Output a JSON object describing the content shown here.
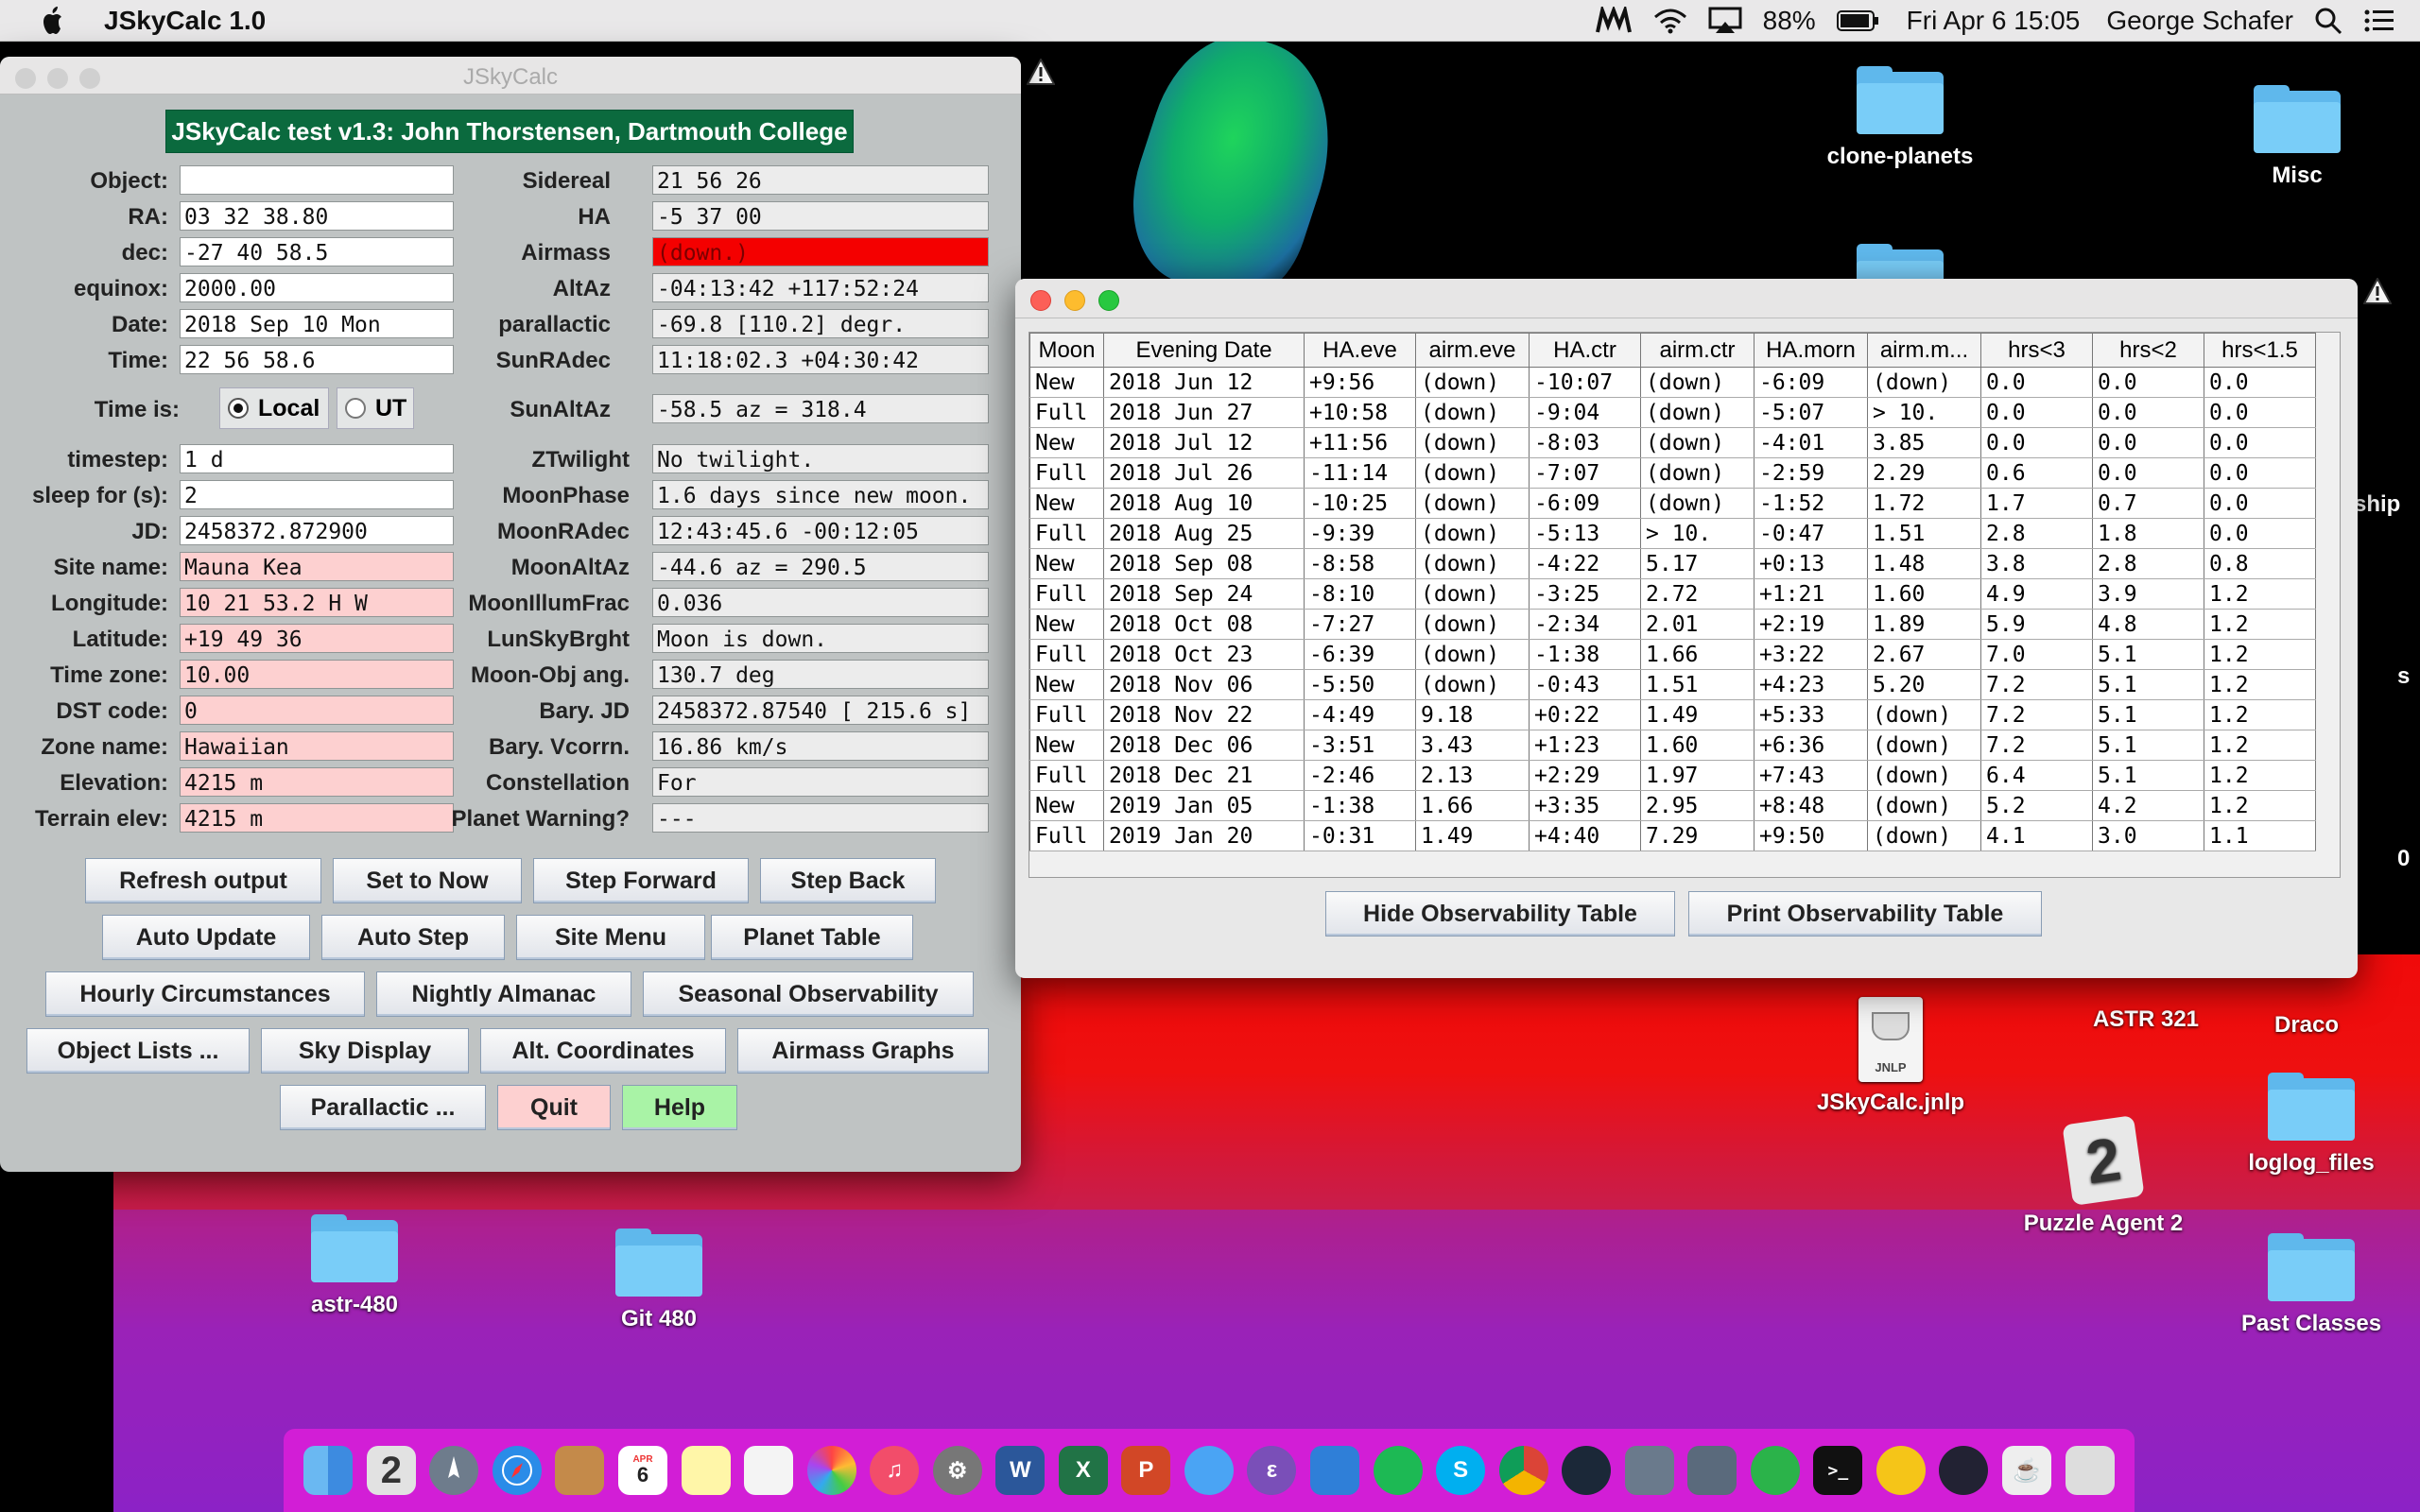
{
  "menubar": {
    "app_name": "JSkyCalc 1.0",
    "battery": "88%",
    "datetime": "Fri Apr 6  15:05",
    "user": "George Schafer"
  },
  "main_window": {
    "title": "JSkyCalc",
    "banner": "JSkyCalc test v1.3: John Thorstensen, Dartmouth College",
    "left_fields": [
      {
        "label": "Object:",
        "value": ""
      },
      {
        "label": "RA:",
        "value": "03 32 38.80"
      },
      {
        "label": "dec:",
        "value": "-27 40 58.5"
      },
      {
        "label": "equinox:",
        "value": "2000.00"
      },
      {
        "label": "Date:",
        "value": "2018 Sep 10  Mon"
      },
      {
        "label": "Time:",
        "value": "22 56 58.6"
      }
    ],
    "right_fields": [
      {
        "label": "Sidereal",
        "value": "21 56 26"
      },
      {
        "label": "HA",
        "value": "-5 37 00"
      },
      {
        "label": "Airmass",
        "value": "(down.)"
      },
      {
        "label": "AltAz",
        "value": "-04:13:42    +117:52:24"
      },
      {
        "label": "parallactic",
        "value": "-69.8  [110.2] degr."
      },
      {
        "label": "SunRAdec",
        "value": "11:18:02.3  +04:30:42"
      }
    ],
    "time_is": {
      "label": "Time is:",
      "local": "Local",
      "ut": "UT",
      "selected": "Local"
    },
    "sunaltaz": {
      "label": "SunAltAz",
      "value": "-58.5   az =  318.4"
    },
    "left_fields2": [
      {
        "label": "timestep:",
        "value": "1 d"
      },
      {
        "label": "sleep for (s):",
        "value": "2"
      },
      {
        "label": "JD:",
        "value": " 2458372.872900"
      },
      {
        "label": "Site name:",
        "value": "Mauna Kea"
      },
      {
        "label": "Longitude:",
        "value": "10 21 53.2 H W"
      },
      {
        "label": "Latitude:",
        "value": "+19 49 36"
      },
      {
        "label": "Time zone:",
        "value": "10.00"
      },
      {
        "label": "DST code:",
        "value": "0"
      },
      {
        "label": "Zone name:",
        "value": " Hawaiian"
      },
      {
        "label": "Elevation:",
        "value": "4215 m"
      },
      {
        "label": "Terrain elev:",
        "value": "4215 m"
      }
    ],
    "right_fields2": [
      {
        "label": "ZTwilight",
        "value": "No twilight."
      },
      {
        "label": "MoonPhase",
        "value": "1.6 days since new moon."
      },
      {
        "label": "MoonRAdec",
        "value": "12:43:45.6  -00:12:05"
      },
      {
        "label": "MoonAltAz",
        "value": "-44.6   az =  290.5"
      },
      {
        "label": "MoonIllumFrac",
        "value": "0.036"
      },
      {
        "label": "LunSkyBrght",
        "value": "Moon is down."
      },
      {
        "label": "Moon-Obj ang.",
        "value": "130.7 deg"
      },
      {
        "label": "Bary. JD",
        "value": "2458372.87540  [ 215.6 s]"
      },
      {
        "label": "Bary. Vcorrn.",
        "value": " 16.86 km/s"
      },
      {
        "label": "Constellation",
        "value": "For"
      },
      {
        "label": "Planet Warning?",
        "value": "---"
      }
    ],
    "buttons": {
      "refresh": "Refresh output",
      "set_now": "Set to Now",
      "step_forward": "Step Forward",
      "step_back": "Step Back",
      "auto_update": "Auto Update",
      "auto_step": "Auto Step",
      "site_menu": "Site  Menu",
      "planet_table": "Planet Table",
      "hourly": "Hourly Circumstances",
      "nightly": "Nightly Almanac",
      "seasonal": "Seasonal Observability",
      "object_lists": "Object Lists ...",
      "sky_display": "Sky Display",
      "alt_coords": "Alt. Coordinates",
      "airmass_graphs": "Airmass Graphs",
      "parallactic": "Parallactic ...",
      "quit": "Quit",
      "help": "Help"
    }
  },
  "obs_window": {
    "headers": [
      "Moon",
      "Evening Date",
      "HA.eve",
      "airm.eve",
      "HA.ctr",
      "airm.ctr",
      "HA.morn",
      "airm.m...",
      "hrs<3",
      "hrs<2",
      "hrs<1.5"
    ],
    "rows": [
      [
        "New",
        "2018 Jun 12",
        "+9:56",
        "(down)",
        "-10:07",
        "(down)",
        "-6:09",
        "(down)",
        "0.0",
        "0.0",
        "0.0"
      ],
      [
        "Full",
        "2018 Jun 27",
        "+10:58",
        "(down)",
        "-9:04",
        "(down)",
        "-5:07",
        "> 10.",
        "0.0",
        "0.0",
        "0.0"
      ],
      [
        "New",
        "2018 Jul 12",
        "+11:56",
        "(down)",
        "-8:03",
        "(down)",
        "-4:01",
        "3.85",
        "0.0",
        "0.0",
        "0.0"
      ],
      [
        "Full",
        "2018 Jul 26",
        "-11:14",
        "(down)",
        "-7:07",
        "(down)",
        "-2:59",
        "2.29",
        "0.6",
        "0.0",
        "0.0"
      ],
      [
        "New",
        "2018 Aug 10",
        "-10:25",
        "(down)",
        "-6:09",
        "(down)",
        "-1:52",
        "1.72",
        "1.7",
        "0.7",
        "0.0"
      ],
      [
        "Full",
        "2018 Aug 25",
        "-9:39",
        "(down)",
        "-5:13",
        "> 10.",
        "-0:47",
        "1.51",
        "2.8",
        "1.8",
        "0.0"
      ],
      [
        "New",
        "2018 Sep 08",
        "-8:58",
        "(down)",
        "-4:22",
        "5.17",
        "+0:13",
        "1.48",
        "3.8",
        "2.8",
        "0.8"
      ],
      [
        "Full",
        "2018 Sep 24",
        "-8:10",
        "(down)",
        "-3:25",
        "2.72",
        "+1:21",
        "1.60",
        "4.9",
        "3.9",
        "1.2"
      ],
      [
        "New",
        "2018 Oct 08",
        "-7:27",
        "(down)",
        "-2:34",
        "2.01",
        "+2:19",
        "1.89",
        "5.9",
        "4.8",
        "1.2"
      ],
      [
        "Full",
        "2018 Oct 23",
        "-6:39",
        "(down)",
        "-1:38",
        "1.66",
        "+3:22",
        "2.67",
        "7.0",
        "5.1",
        "1.2"
      ],
      [
        "New",
        "2018 Nov 06",
        "-5:50",
        "(down)",
        "-0:43",
        "1.51",
        "+4:23",
        "5.20",
        "7.2",
        "5.1",
        "1.2"
      ],
      [
        "Full",
        "2018 Nov 22",
        "-4:49",
        "9.18",
        "+0:22",
        "1.49",
        "+5:33",
        "(down)",
        "7.2",
        "5.1",
        "1.2"
      ],
      [
        "New",
        "2018 Dec 06",
        "-3:51",
        "3.43",
        "+1:23",
        "1.60",
        "+6:36",
        "(down)",
        "7.2",
        "5.1",
        "1.2"
      ],
      [
        "Full",
        "2018 Dec 21",
        "-2:46",
        "2.13",
        "+2:29",
        "1.97",
        "+7:43",
        "(down)",
        "6.4",
        "5.1",
        "1.2"
      ],
      [
        "New",
        "2019 Jan 05",
        "-1:38",
        "1.66",
        "+3:35",
        "2.95",
        "+8:48",
        "(down)",
        "5.2",
        "4.2",
        "1.2"
      ],
      [
        "Full",
        "2019 Jan 20",
        "-0:31",
        "1.49",
        "+4:40",
        "7.29",
        "+9:50",
        "(down)",
        "4.1",
        "3.0",
        "1.1"
      ]
    ],
    "hide_button": "Hide Observability Table",
    "print_button": "Print Observability Table"
  },
  "desktop_icons": {
    "clone_planets": "clone-planets",
    "misc": "Misc",
    "ship_partial": "ship",
    "s_partial": "s",
    "zero_partial": "0",
    "astr321": "ASTR 321",
    "draco": "Draco",
    "jskycalc_jnlp": "JSkyCalc.jnlp",
    "jnlp_badge": "JNLP",
    "loglog": "loglog_files",
    "puzzle": "Puzzle Agent 2",
    "past_classes": "Past Classes",
    "astr480": "astr-480",
    "git480": "Git 480"
  },
  "dock": {
    "calendar_month": "APR",
    "calendar_day": "6"
  },
  "colors": {
    "banner_bg": "#0b6a3e",
    "airmass_red": "#f40000",
    "quit_pink": "#fdd0d0",
    "help_green": "#a9f3a6",
    "desktop_red": "#ee1010",
    "desktop_purple": "#9a22b8",
    "folder_blue": "#79cdf8"
  }
}
